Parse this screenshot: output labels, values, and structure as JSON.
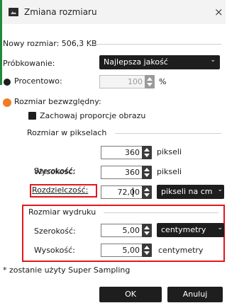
{
  "window": {
    "title": "Zmiana rozmiaru",
    "close_glyph": "×"
  },
  "new_size": {
    "label": "Nowy rozmiar: 506,3 KB"
  },
  "sampling": {
    "label": "Próbkowanie:",
    "value": "Najlepsza jakość"
  },
  "percent": {
    "label": "Procentowo:",
    "value": "100",
    "unit": "%"
  },
  "absolute": {
    "label": "Rozmiar bezwzględny:"
  },
  "keep_ratio": {
    "label": "Zachowaj proporcje obrazu"
  },
  "pixels": {
    "group_label": "Rozmiar w pikselach",
    "width_label": "Szerokość:",
    "width_value": "360",
    "width_unit": "pikseli",
    "height_label": "Wysokość:",
    "height_value": "360",
    "height_unit": "pikseli"
  },
  "resolution": {
    "label": "Rozdzielczość:",
    "value": "72,00",
    "unit": "pikseli na cm"
  },
  "print": {
    "group_label": "Rozmiar wydruku",
    "width_label": "Szerokość:",
    "width_value": "5,00",
    "width_unit": "centymetry",
    "height_label": "Wysokość:",
    "height_value": "5,00",
    "height_unit": "centymetry"
  },
  "note": "* zostanie użyty Super Sampling",
  "buttons": {
    "ok": "OK",
    "cancel": "Anuluj"
  },
  "colors": {
    "accent": "#e3171c",
    "control_dark": "#1e1e1e",
    "orange_radio": "#f07d23"
  }
}
